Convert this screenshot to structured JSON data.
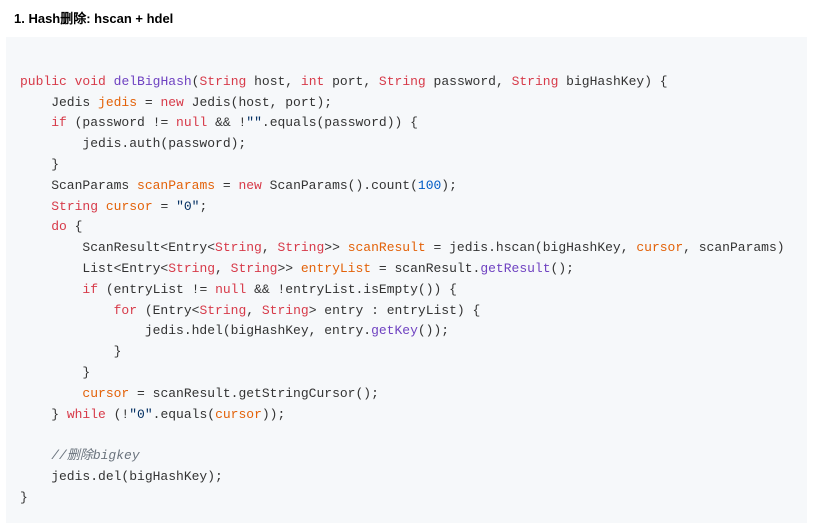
{
  "heading": "1. Hash删除: hscan + hdel",
  "code": {
    "t1": "public",
    "t2": "void",
    "t3": "delBigHash",
    "t4": "String",
    "t5": " host, ",
    "t6": "int",
    "t7": " port, ",
    "t8": "String",
    "t9": " password, ",
    "t10": "String",
    "t11": " bigHashKey) {",
    "l2a": "    Jedis ",
    "l2b": "jedis",
    "l2c": " = ",
    "l2d": "new",
    "l2e": " Jedis(host, port);",
    "l3a": "    ",
    "l3b": "if",
    "l3c": " (password != ",
    "l3d": "null",
    "l3e": " && !",
    "l3f": "\"\"",
    "l3g": ".equals(password)) {",
    "l4a": "        jedis.auth(password);",
    "l5a": "    }",
    "l6a": "    ScanParams ",
    "l6b": "scanParams",
    "l6c": " = ",
    "l6d": "new",
    "l6e": " ScanParams().count(",
    "l6f": "100",
    "l6g": ");",
    "l7a": "    ",
    "l7b": "String",
    "l7c": " ",
    "l7d": "cursor",
    "l7e": " = ",
    "l7f": "\"0\"",
    "l7g": ";",
    "l8a": "    ",
    "l8b": "do",
    "l8c": " {",
    "l9a": "        ScanResult<Entry<",
    "l9b": "String",
    "l9c": ", ",
    "l9d": "String",
    "l9e": ">> ",
    "l9f": "scanResult",
    "l9g": " = jedis.hscan(bigHashKey, ",
    "l9h": "cursor",
    "l9i": ", scanParams)",
    "l10a": "        List<Entry<",
    "l10b": "String",
    "l10c": ", ",
    "l10d": "String",
    "l10e": ">> ",
    "l10f": "entryList",
    "l10g": " = scanResult.",
    "l10h": "getResult",
    "l10i": "();",
    "l11a": "        ",
    "l11b": "if",
    "l11c": " (entryList != ",
    "l11d": "null",
    "l11e": " && !entryList.isEmpty()) {",
    "l12a": "            ",
    "l12b": "for",
    "l12c": " (Entry<",
    "l12d": "String",
    "l12e": ", ",
    "l12f": "String",
    "l12g": "> entry : entryList) {",
    "l13a": "                jedis.hdel(bigHashKey, entry.",
    "l13b": "getKey",
    "l13c": "());",
    "l14a": "            }",
    "l15a": "        }",
    "l16a": "        ",
    "l16b": "cursor",
    "l16c": " = scanResult.getStringCursor();",
    "l17a": "    } ",
    "l17b": "while",
    "l17c": " (!",
    "l17d": "\"0\"",
    "l17e": ".equals(",
    "l17f": "cursor",
    "l17g": "));",
    "l18a": "",
    "l19a": "    ",
    "l19b": "//删除bigkey",
    "l20a": "    jedis.del(bigHashKey);",
    "l21a": "}"
  }
}
